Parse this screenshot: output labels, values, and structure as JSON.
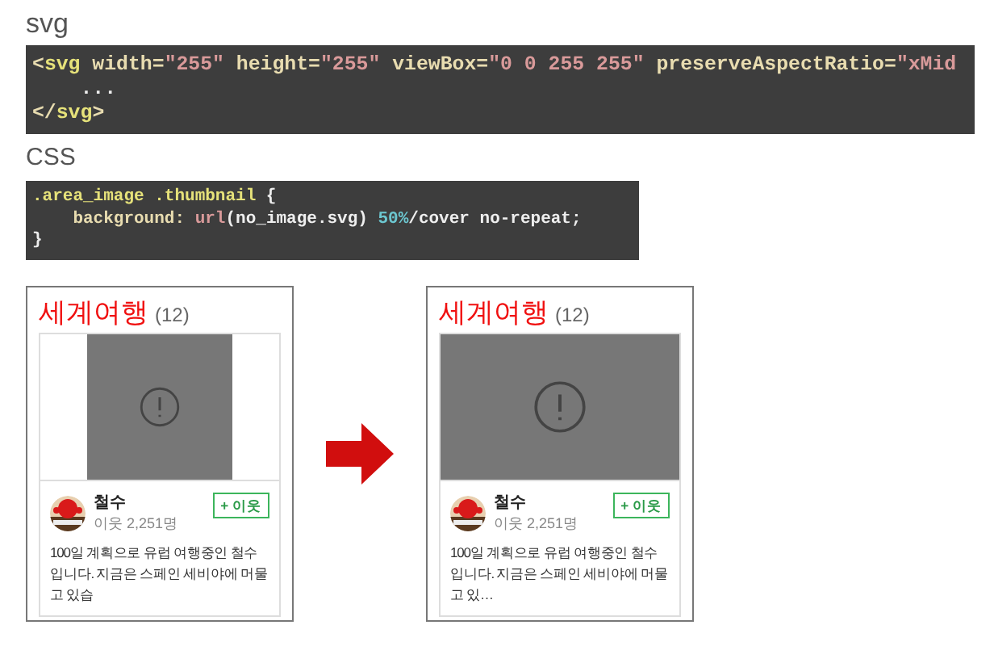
{
  "sections": [
    {
      "heading": "svg",
      "lines": [
        [
          {
            "kind": "punct",
            "text": "<"
          },
          {
            "kind": "tag",
            "text": "svg"
          },
          {
            "kind": "attr",
            "text": " width="
          },
          {
            "kind": "string",
            "text": "\"255\""
          },
          {
            "kind": "attr",
            "text": " height="
          },
          {
            "kind": "string",
            "text": "\"255\""
          },
          {
            "kind": "attr",
            "text": " viewBox="
          },
          {
            "kind": "string",
            "text": "\"0 0 255 255\""
          },
          {
            "kind": "attr",
            "text": " preserveAspectRatio="
          },
          {
            "kind": "string",
            "text": "\"xMid"
          }
        ],
        [
          {
            "kind": "plain",
            "text": "    ..."
          }
        ],
        [
          {
            "kind": "punct",
            "text": "</"
          },
          {
            "kind": "tag",
            "text": "svg"
          },
          {
            "kind": "punct",
            "text": ">"
          }
        ]
      ]
    },
    {
      "heading": "CSS",
      "lines": [
        [
          {
            "kind": "tag",
            "text": ".area_image .thumbnail"
          },
          {
            "kind": "plain",
            "text": " {"
          }
        ],
        [
          {
            "kind": "attr",
            "text": "    background: "
          },
          {
            "kind": "string",
            "text": "url"
          },
          {
            "kind": "plain",
            "text": "(no_image.svg) "
          },
          {
            "kind": "number",
            "text": "50%"
          },
          {
            "kind": "plain",
            "text": "/cover no-repeat;"
          }
        ],
        [
          {
            "kind": "plain",
            "text": "}"
          }
        ]
      ]
    }
  ],
  "cards": [
    {
      "title": "세계여행",
      "count": "(12)",
      "image_cropped": false,
      "name": "철수",
      "neighbors": "이웃 2,251명",
      "button": "+ 이웃",
      "description": "100일 계획으로 유럽 여행중인 철수입니다. 지금은 스페인 세비야에 머물고 있습"
    },
    {
      "title": "세계여행",
      "count": "(12)",
      "image_cropped": true,
      "name": "철수",
      "neighbors": "이웃 2,251명",
      "button": "+ 이웃",
      "description": "100일 계획으로 유럽 여행중인 철수입니다. 지금은 스페인 세비야에 머물고 있…"
    }
  ]
}
